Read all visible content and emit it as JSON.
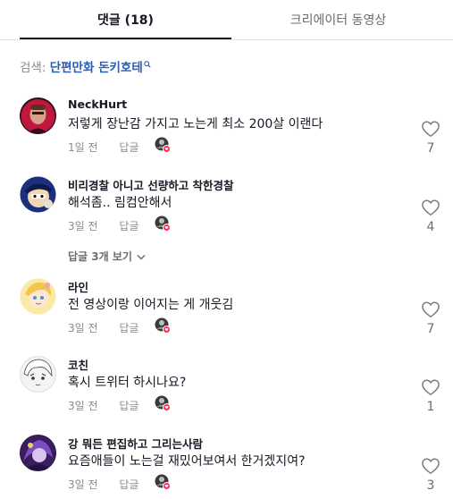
{
  "tabs": [
    {
      "label": "댓글 (18)",
      "active": true
    },
    {
      "label": "크리에이터 동영상",
      "active": false
    }
  ],
  "search": {
    "label": "검색:",
    "keyword": "단편만화 돈키호테"
  },
  "comments": [
    {
      "username": "NeckHurt",
      "text": "저렇게 장난감 가지고 노는게 최소 200살 이랜다",
      "time": "1일 전",
      "reply": "답글",
      "likes": "7"
    },
    {
      "username": "비리경찰 아니고 선량하고 착한경찰",
      "text": "해석좀.. 림컴안해서",
      "time": "3일 전",
      "reply": "답글",
      "likes": "4",
      "view_replies": "답글 3개 보기"
    },
    {
      "username": "라인",
      "text": "전 영상이랑 이어지는 게 개웃김",
      "time": "3일 전",
      "reply": "답글",
      "likes": "7"
    },
    {
      "username": "코친",
      "text": "혹시 트위터 하시나요?",
      "time": "3일 전",
      "reply": "답글",
      "likes": "1"
    },
    {
      "username": "강 뭐든 편집하고 그리는사람",
      "text": "요즘애들이 노는걸 재밌어보여서 한거겠지여?",
      "time": "3일 전",
      "reply": "답글",
      "likes": "3"
    }
  ],
  "colors": {
    "accent_link": "#2b5db0",
    "heart_badge": "#fe2c55",
    "muted_text": "#8a8b91"
  }
}
